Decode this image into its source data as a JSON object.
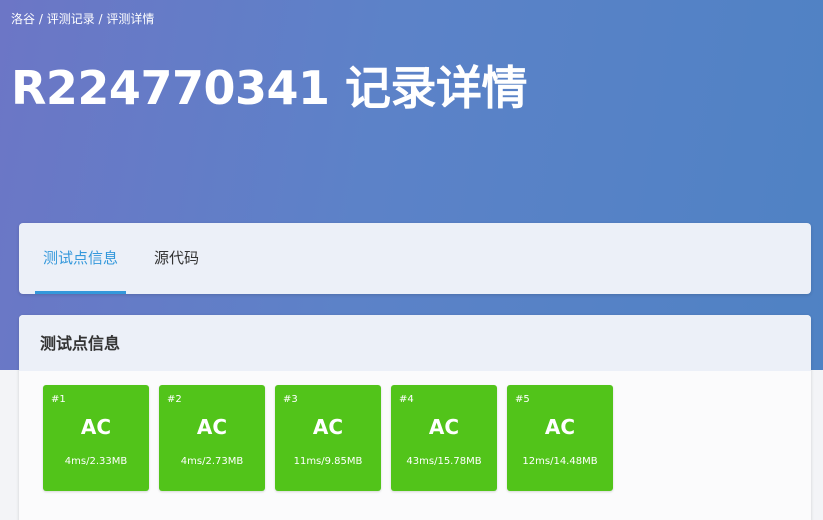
{
  "breadcrumb": {
    "items": [
      "洛谷",
      "评测记录",
      "评测详情"
    ],
    "separator": " / "
  },
  "header": {
    "title": "R224770341 记录详情"
  },
  "tabs": [
    {
      "label": "测试点信息",
      "active": true
    },
    {
      "label": "源代码",
      "active": false
    }
  ],
  "panel": {
    "title": "测试点信息",
    "cases": [
      {
        "num": "#1",
        "status": "AC",
        "meta": "4ms/2.33MB"
      },
      {
        "num": "#2",
        "status": "AC",
        "meta": "4ms/2.73MB"
      },
      {
        "num": "#3",
        "status": "AC",
        "meta": "11ms/9.85MB"
      },
      {
        "num": "#4",
        "status": "AC",
        "meta": "43ms/15.78MB"
      },
      {
        "num": "#5",
        "status": "AC",
        "meta": "12ms/14.48MB"
      }
    ]
  },
  "colors": {
    "accent": "#3498db",
    "ac_green": "#52c41a",
    "hero_start": "#6c76c6",
    "hero_end": "#4f82c4"
  }
}
